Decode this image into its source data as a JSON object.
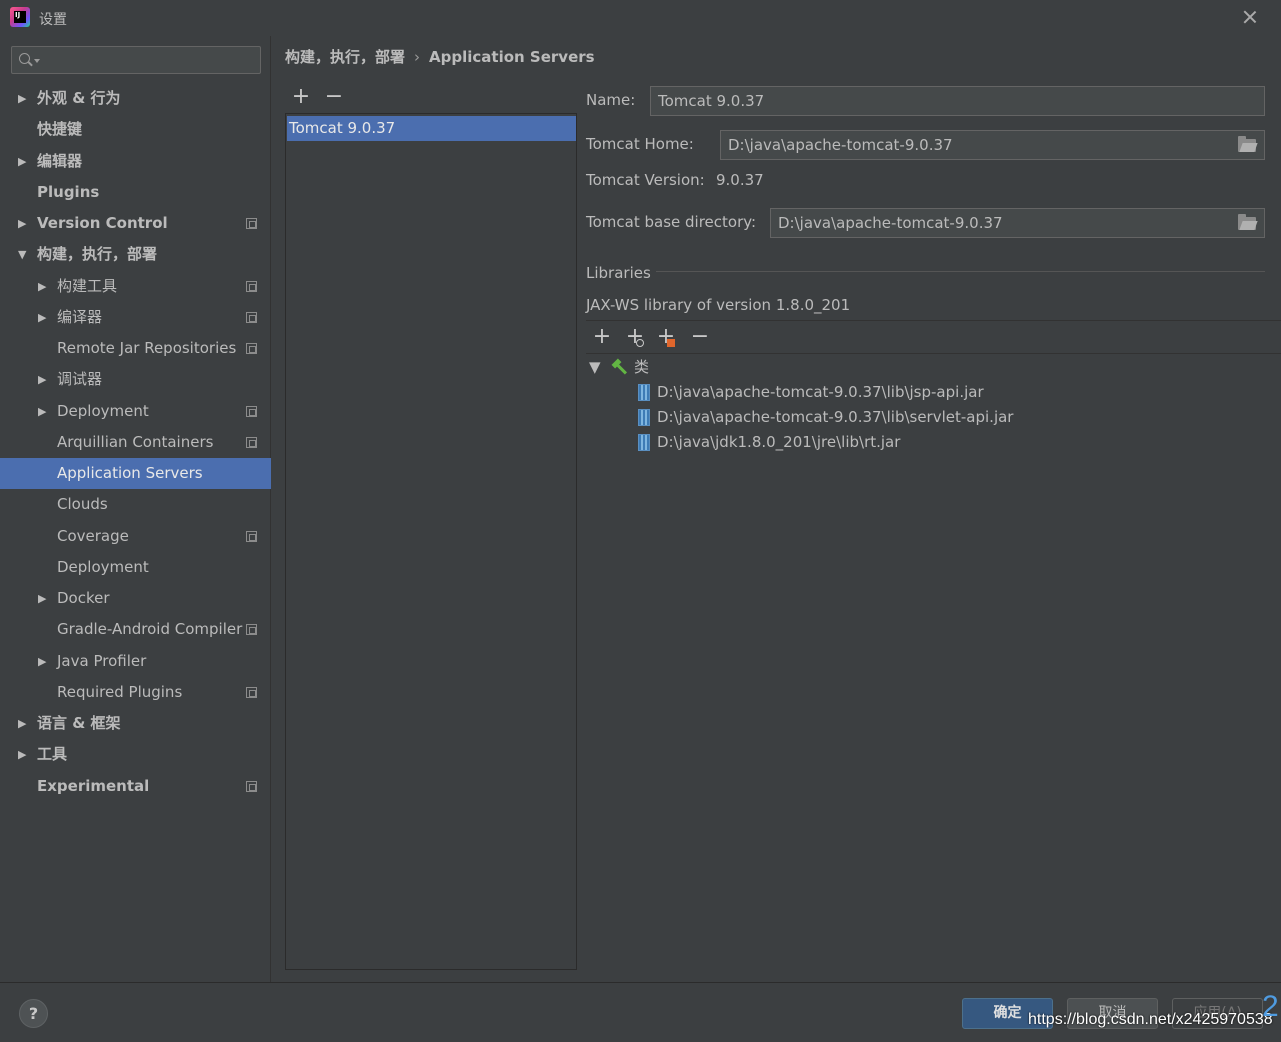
{
  "window": {
    "title": "设置"
  },
  "search": {
    "placeholder": ""
  },
  "sidebar": {
    "items": [
      {
        "label": "外观 & 行为",
        "level": 0,
        "arrow": "▶",
        "bold": true,
        "icon": false,
        "selected": false
      },
      {
        "label": "快捷键",
        "level": 0,
        "arrow": "",
        "bold": true,
        "icon": false,
        "selected": false
      },
      {
        "label": "编辑器",
        "level": 0,
        "arrow": "▶",
        "bold": true,
        "icon": false,
        "selected": false
      },
      {
        "label": "Plugins",
        "level": 0,
        "arrow": "",
        "bold": true,
        "icon": false,
        "selected": false
      },
      {
        "label": "Version Control",
        "level": 0,
        "arrow": "▶",
        "bold": true,
        "icon": true,
        "selected": false
      },
      {
        "label": "构建，执行，部署",
        "level": 0,
        "arrow": "▼",
        "bold": true,
        "icon": false,
        "selected": false
      },
      {
        "label": "构建工具",
        "level": 1,
        "arrow": "▶",
        "bold": false,
        "icon": true,
        "selected": false
      },
      {
        "label": "编译器",
        "level": 1,
        "arrow": "▶",
        "bold": false,
        "icon": true,
        "selected": false
      },
      {
        "label": "Remote Jar Repositories",
        "level": 1,
        "arrow": "",
        "bold": false,
        "icon": true,
        "selected": false
      },
      {
        "label": "调试器",
        "level": 1,
        "arrow": "▶",
        "bold": false,
        "icon": false,
        "selected": false
      },
      {
        "label": "Deployment",
        "level": 1,
        "arrow": "▶",
        "bold": false,
        "icon": true,
        "selected": false
      },
      {
        "label": "Arquillian Containers",
        "level": 1,
        "arrow": "",
        "bold": false,
        "icon": true,
        "selected": false
      },
      {
        "label": "Application Servers",
        "level": 1,
        "arrow": "",
        "bold": false,
        "icon": false,
        "selected": true
      },
      {
        "label": "Clouds",
        "level": 1,
        "arrow": "",
        "bold": false,
        "icon": false,
        "selected": false
      },
      {
        "label": "Coverage",
        "level": 1,
        "arrow": "",
        "bold": false,
        "icon": true,
        "selected": false
      },
      {
        "label": "Deployment",
        "level": 1,
        "arrow": "",
        "bold": false,
        "icon": false,
        "selected": false
      },
      {
        "label": "Docker",
        "level": 1,
        "arrow": "▶",
        "bold": false,
        "icon": false,
        "selected": false
      },
      {
        "label": "Gradle-Android Compiler",
        "level": 1,
        "arrow": "",
        "bold": false,
        "icon": true,
        "selected": false
      },
      {
        "label": "Java Profiler",
        "level": 1,
        "arrow": "▶",
        "bold": false,
        "icon": false,
        "selected": false
      },
      {
        "label": "Required Plugins",
        "level": 1,
        "arrow": "",
        "bold": false,
        "icon": true,
        "selected": false
      },
      {
        "label": "语言 & 框架",
        "level": 0,
        "arrow": "▶",
        "bold": true,
        "icon": false,
        "selected": false
      },
      {
        "label": "工具",
        "level": 0,
        "arrow": "▶",
        "bold": true,
        "icon": false,
        "selected": false
      },
      {
        "label": "Experimental",
        "level": 0,
        "arrow": "",
        "bold": true,
        "icon": true,
        "selected": false
      }
    ]
  },
  "breadcrumb": {
    "parent": "构建，执行，部署",
    "separator": "›",
    "current": "Application Servers"
  },
  "server_list": {
    "add": "+",
    "remove": "−",
    "items": [
      "Tomcat 9.0.37"
    ]
  },
  "form": {
    "name_label": "Name:",
    "name_value": "Tomcat 9.0.37",
    "home_label": "Tomcat Home:",
    "home_value": "D:\\java\\apache-tomcat-9.0.37",
    "version_label": "Tomcat Version:",
    "version_value": "9.0.37",
    "base_label": "Tomcat base directory:",
    "base_value": "D:\\java\\apache-tomcat-9.0.37"
  },
  "libraries": {
    "title": "Libraries",
    "jaxws": "JAX-WS library of version 1.8.0_201",
    "root_label": "类",
    "jars": [
      "D:\\java\\apache-tomcat-9.0.37\\lib\\jsp-api.jar",
      "D:\\java\\apache-tomcat-9.0.37\\lib\\servlet-api.jar",
      "D:\\java\\jdk1.8.0_201\\jre\\lib\\rt.jar"
    ]
  },
  "buttons": {
    "help": "?",
    "ok": "确定",
    "cancel": "取消",
    "apply": "应用(A)"
  },
  "watermark": {
    "text": "https://blog.csdn.net/x2425970538",
    "number": "2"
  },
  "colors": {
    "selection": "#4b6eaf",
    "background": "#3c3f41",
    "ok_button": "#365880"
  }
}
